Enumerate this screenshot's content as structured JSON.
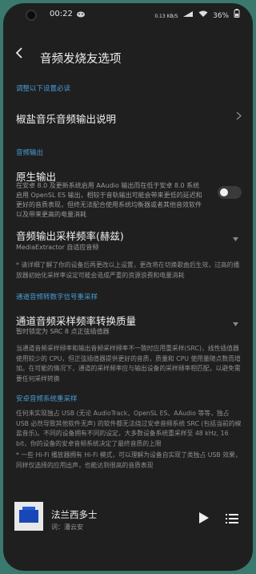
{
  "status_bar": {
    "time": "00:22",
    "net_speed": "0.13 KB/S",
    "battery": "36%",
    "icons": [
      "signal-icon",
      "wifi-icon",
      "battery-icon"
    ]
  },
  "header": {
    "title": "音频发烧友选项"
  },
  "sections": {
    "adjust": "调整以下设置必读",
    "audio_output": "音频输出",
    "channel_resample": "通道音频转数字信号重采样",
    "bypass": "安卓音频系统重采样"
  },
  "items": {
    "guide": {
      "title": "椒盐音乐音频输出说明"
    },
    "native": {
      "title": "原生输出",
      "desc": "在安卓 8.0 及更新系统启用 AAudio 输出而在低于安卓 8.0 系统启用 OpenSL ES 输出，相较于音轨输出可能会带来更低的延迟和更好的音质表现，但终无法配合使用系统均衡器或者其他音效软件以及带来更高的电量消耗"
    },
    "sample_rate": {
      "title": "音频输出采样频率(赫兹)",
      "value": "MediaExtractor 自适应音频"
    },
    "rate_note": "* 请详细了解了你的设备后再更改以上设置，更改将在切换歌曲后生效，过高的播放器初始化采样率设定可能会造成严重的资源浪费和电量消耗",
    "resample_quality": {
      "title": "通道音频采样频率转换质量",
      "value": "暂时锁定为 SRC 8 点正弦插值器"
    },
    "resample_note": "当通道音频采样频率和输出音频采样频率不一致时应用重采样(SRC)，线性插值器使用较少的 CPU，但正弦插值器提供更好的音质，质量和 CPU 使用量随点数而增加。在可能的情况下，通道的采样频率应与输出设备的采样频率相匹配，以避免需要任何采样转换",
    "bypass_note": "任何未实现独占 USB (无论 AudioTrack、OpenSL ES、AAudio 等等，独占 USB 必然导致其他软件无声) 的软件都无法绕过安卓音频系统 SRC (包括当前的椒盐音乐)。不同的设备拥有不同的设定，大多数设备系统重采样至 48 kHz, 16 bit，你的设备的安卓音频系统决定了最终音质的上限",
    "hifi_note": "* 一些 Hi-Fi 播放器拥有 Hi-Fi 模式，可以理解为设备自实现了类独占 USB 效果，同样仅选择的应用出声，也能达到很高的音质表现"
  },
  "player": {
    "song": "法兰西多士",
    "artist": "词：潘云安"
  },
  "colors": {
    "accent": "#4a9bd6",
    "background": "#1f1f1f"
  }
}
